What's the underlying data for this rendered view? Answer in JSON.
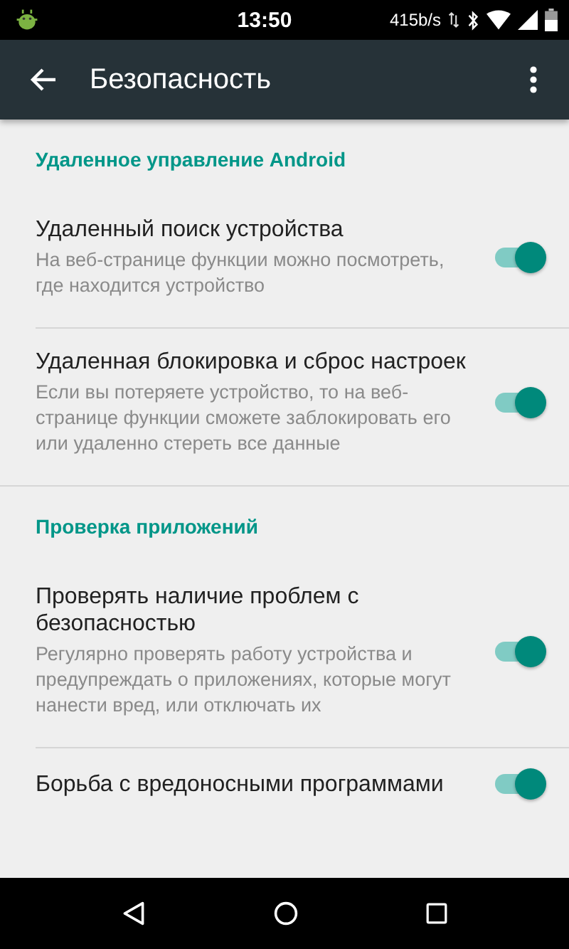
{
  "status_bar": {
    "time": "13:50",
    "speed": "415b/s"
  },
  "toolbar": {
    "title": "Безопасность"
  },
  "sections": [
    {
      "header": "Удаленное управление Android",
      "items": [
        {
          "title": "Удаленный поиск устройства",
          "description": "На веб-странице функции можно посмотреть, где находится устройство",
          "on": true
        },
        {
          "title": "Удаленная блокировка и сброс настроек",
          "description": "Если вы потеряете устройство, то на веб-странице функции сможете заблокировать его или удаленно стереть все данные",
          "on": true
        }
      ]
    },
    {
      "header": "Проверка приложений",
      "items": [
        {
          "title": "Проверять наличие проблем с безопасностью",
          "description": "Регулярно проверять работу устройства и предупреждать о приложениях, которые могут нанести вред, или отключать их",
          "on": true
        },
        {
          "title": "Борьба с вредоносными программами",
          "on": true
        }
      ]
    }
  ]
}
